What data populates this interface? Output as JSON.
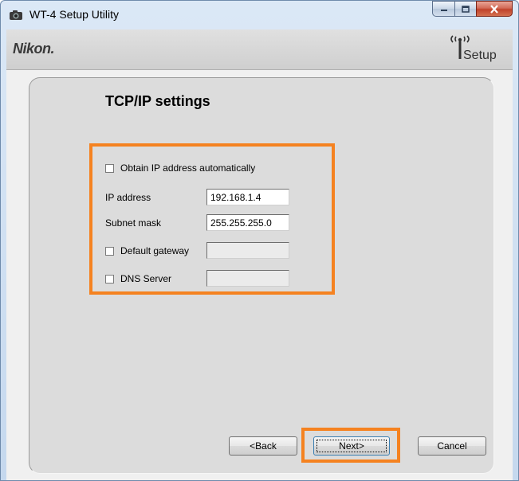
{
  "window": {
    "title": "WT-4 Setup Utility"
  },
  "brand": {
    "logo_text": "Nikon.",
    "setup_logo_text": "Setup"
  },
  "page": {
    "heading": "TCP/IP settings"
  },
  "form": {
    "obtain_auto_label": "Obtain IP address automatically",
    "ip_address_label": "IP address",
    "ip_address_value": "192.168.1.4",
    "subnet_mask_label": "Subnet mask",
    "subnet_mask_value": "255.255.255.0",
    "default_gateway_label": "Default gateway",
    "default_gateway_value": "",
    "dns_server_label": "DNS Server",
    "dns_server_value": ""
  },
  "buttons": {
    "back": "<Back",
    "next": "Next>",
    "cancel": "Cancel"
  },
  "colors": {
    "highlight": "#f58220",
    "titlebar": "#c5d8ee",
    "panel": "#dcdcdc"
  }
}
